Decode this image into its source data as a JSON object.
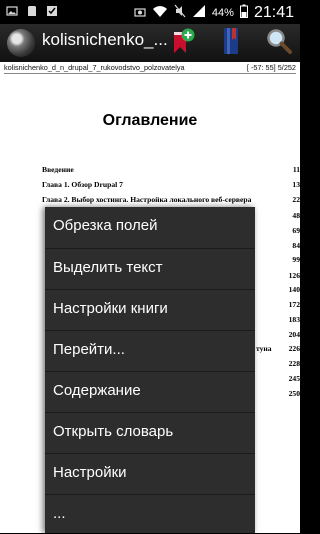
{
  "status_bar": {
    "battery": "44%",
    "time": "21:41"
  },
  "action_bar": {
    "title": "kolisnichenko_..."
  },
  "reader": {
    "filename": "kolisnichenko_d_n_drupal_7_rukovodstvo_polzovatelya",
    "page_stats": "[ -57: 55]  5/252"
  },
  "page": {
    "heading": "Оглавление",
    "toc": [
      {
        "title": "Введение",
        "page": "11"
      },
      {
        "title": "Глава 1. Обзор Drupal 7",
        "page": "13"
      },
      {
        "title": "Глава 2. Выбор хостинга. Настройка локального веб-сервера",
        "page": "22"
      },
      {
        "title": "",
        "page": "48"
      },
      {
        "title": "",
        "page": "69"
      },
      {
        "title": "",
        "page": "84"
      },
      {
        "title": "",
        "page": "99"
      },
      {
        "title": "",
        "page": "126"
      },
      {
        "title": "",
        "page": "140"
      },
      {
        "title": "",
        "page": "172"
      },
      {
        "title": "",
        "page": "183"
      },
      {
        "title": "",
        "page": "204"
      },
      {
        "title": "туна",
        "page": "226"
      },
      {
        "title": "",
        "page": "228"
      },
      {
        "title": "",
        "page": "245"
      },
      {
        "title": "",
        "page": "250"
      }
    ]
  },
  "context_menu": {
    "items": [
      {
        "label": "Обрезка полей"
      },
      {
        "label": "Выделить текст"
      },
      {
        "label": "Настройки книги"
      },
      {
        "label": "Перейти..."
      },
      {
        "label": "Содержание"
      },
      {
        "label": "Открыть словарь"
      },
      {
        "label": "Настройки"
      },
      {
        "label": "..."
      }
    ]
  },
  "icons": {
    "status_left": [
      "image-icon",
      "sd-card-icon",
      "task-done-icon"
    ],
    "status_right": [
      "screenshot-icon",
      "wifi-icon",
      "mute-icon",
      "signal-icon",
      "battery-icon"
    ],
    "action_bar": [
      "book-reader-app-icon",
      "bookmark-add-icon",
      "library-icon",
      "search-icon"
    ]
  },
  "colors": {
    "menu_bg": "#2d2d2d",
    "action_bar_bg": "#1e1e1e",
    "bookmark_red": "#c8102e",
    "add_green": "#2fa84f",
    "library_blue": "#1c3c8a",
    "library_red": "#c03030"
  }
}
